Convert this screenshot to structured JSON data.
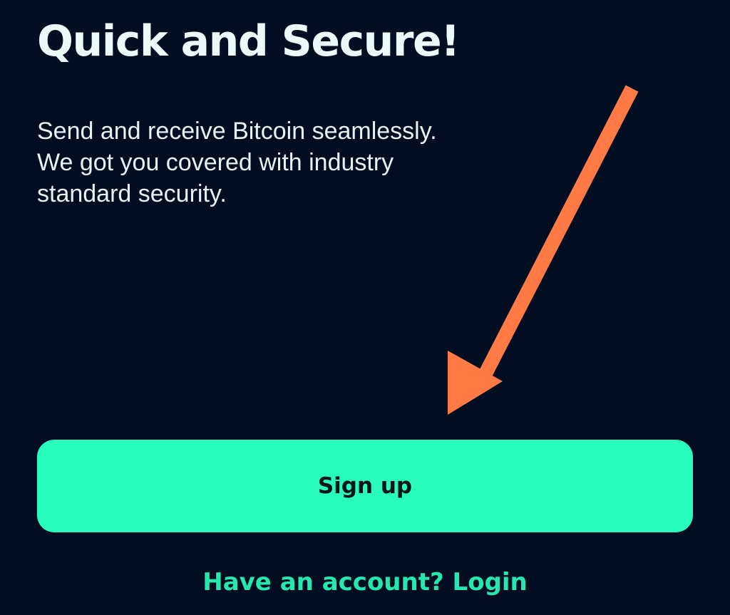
{
  "colors": {
    "background": "#020d22",
    "title_text": "#e9fbf8",
    "body_text": "#e6f1f2",
    "primary_button": "#29fdbb",
    "primary_button_text": "#0a1518",
    "link_text": "#24e8ad",
    "annotation_arrow": "#ff7a45"
  },
  "screen": {
    "title": "Quick and Secure!",
    "description_lines": [
      "Send and receive Bitcoin seamlessly.",
      "We got you covered with industry",
      "standard security."
    ]
  },
  "actions": {
    "signup_label": "Sign up",
    "login_prompt": "Have an account? Login"
  },
  "annotation": {
    "icon": "arrow-icon"
  }
}
